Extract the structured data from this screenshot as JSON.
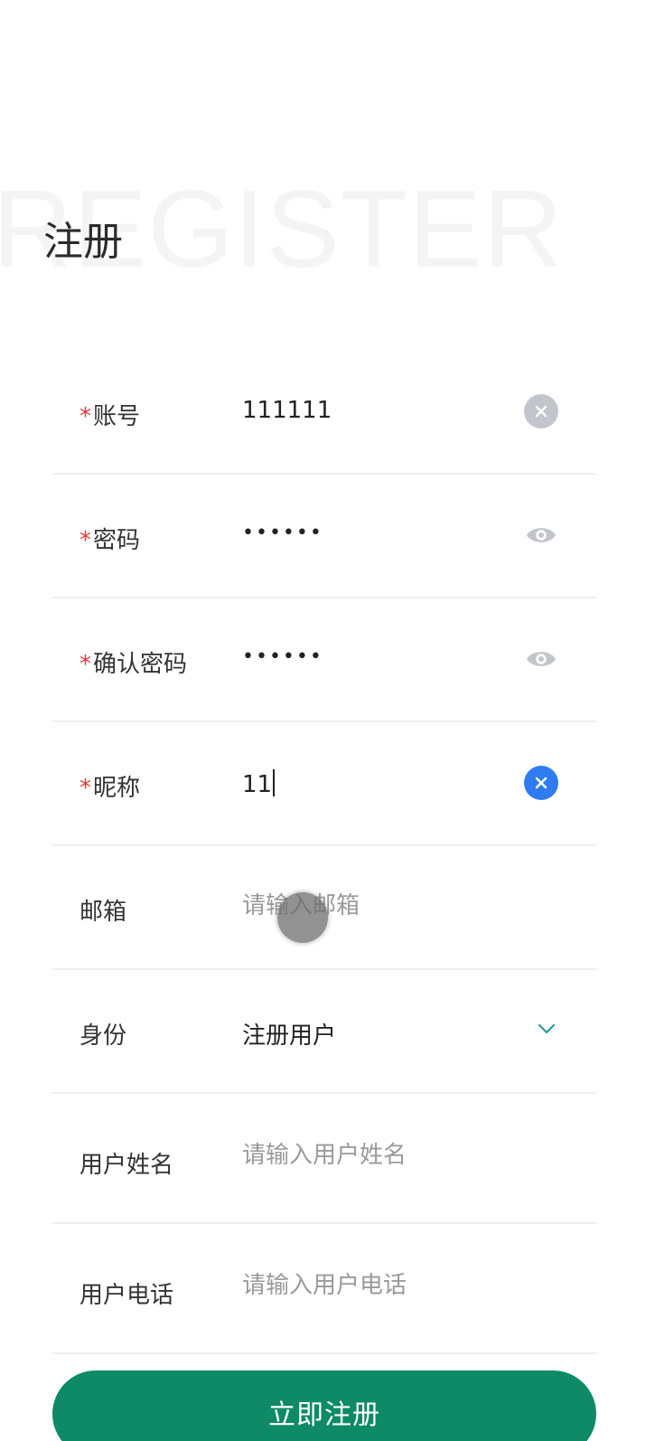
{
  "watermark": "REGISTER",
  "title": "注册",
  "required_mark": "*",
  "fields": {
    "account": {
      "label": "账号",
      "value": "111111"
    },
    "password": {
      "label": "密码",
      "value": "••••••"
    },
    "confirm_password": {
      "label": "确认密码",
      "value": "••••••"
    },
    "nickname": {
      "label": "昵称",
      "value": "11"
    },
    "email": {
      "label": "邮箱",
      "value": "",
      "placeholder": "请输入邮箱"
    },
    "identity": {
      "label": "身份",
      "value": "注册用户"
    },
    "real_name": {
      "label": "用户姓名",
      "value": "",
      "placeholder": "请输入用户姓名"
    },
    "phone": {
      "label": "用户电话",
      "value": "",
      "placeholder": "请输入用户电话"
    }
  },
  "submit_label": "立即注册",
  "icons": {
    "clear": "clear-icon",
    "eye": "eye-icon",
    "chevron": "chevron-down-icon"
  },
  "colors": {
    "accent": "#0e8a66",
    "required": "#e53935",
    "clear_active": "#2f7bf2",
    "clear_inactive": "#c2c6cc"
  }
}
